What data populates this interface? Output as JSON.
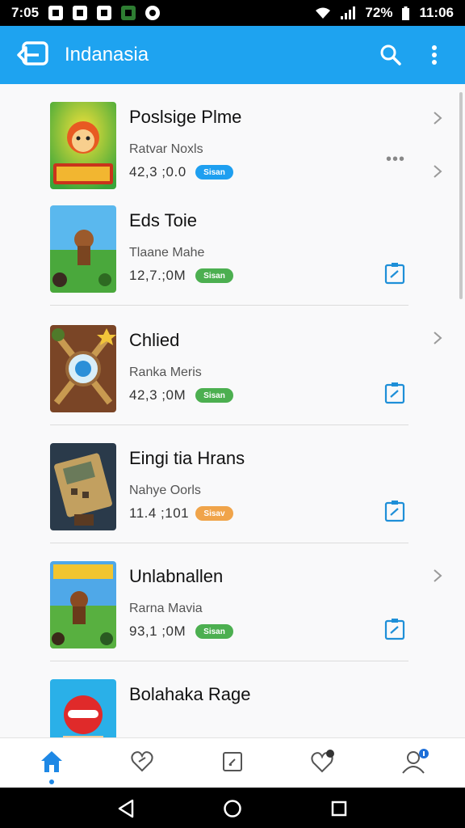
{
  "status_bar": {
    "time": "7:05",
    "battery": "72%",
    "clock": "11:06"
  },
  "app_bar": {
    "title": "Indanasia",
    "actions": [
      "search-icon",
      "more-vert-icon"
    ]
  },
  "items": [
    {
      "title": "Poslsige Plme",
      "subtitle": "Ratvar Noxls",
      "size": "42,3 ;0.0",
      "badge": "Sisan",
      "badge_color": "#1e9ff0"
    },
    {
      "title": "Eds Toie",
      "subtitle": "Tlaane Mahe",
      "size": "12,7.;0M",
      "badge": "Sisan",
      "badge_color": "#4caf50"
    },
    {
      "title": "Chlied",
      "subtitle": "Ranka Meris",
      "size": "42,3 ;0M",
      "badge": "Sisan",
      "badge_color": "#4caf50"
    },
    {
      "title": "Eingi tia Hrans",
      "subtitle": "Nahye Oorls",
      "size": "11.4 ;101",
      "badge": "Sisav",
      "badge_color": "#f0a44a"
    },
    {
      "title": "Unlabnallen",
      "subtitle": "Rarna Mavia",
      "size": "93,1 ;0M",
      "badge": "Sisan",
      "badge_color": "#4caf50"
    },
    {
      "title": "Bolahaka Rage",
      "subtitle": "",
      "size": "",
      "badge": "",
      "badge_color": "#4caf50"
    }
  ],
  "bottom_nav": {
    "tabs": [
      "home-icon",
      "favorites-icon",
      "library-icon",
      "notifications-icon",
      "profile-icon"
    ],
    "active": "home-icon",
    "accent": "#1e88e5"
  },
  "colors": {
    "app_bar": "#1ea3f0",
    "accent_icon": "#1e8fd8"
  }
}
